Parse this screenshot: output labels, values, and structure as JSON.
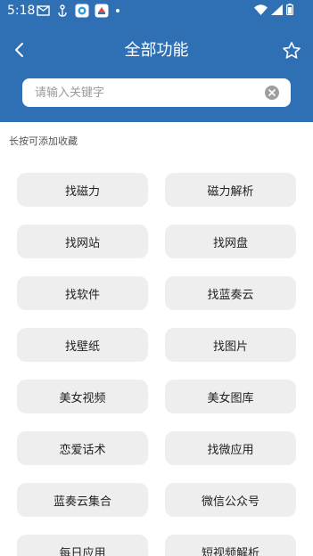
{
  "status_bar": {
    "time": "5:18",
    "icons_left": [
      "mail-icon",
      "anchor-icon",
      "app-icon-a",
      "app-icon-b"
    ],
    "icons_right": [
      "wifi-icon",
      "signal-icon",
      "battery-icon"
    ]
  },
  "header": {
    "title": "全部功能",
    "back_icon": "back-arrow-icon",
    "favorite_icon": "star-icon"
  },
  "search": {
    "placeholder": "请输入关键字",
    "value": ""
  },
  "content": {
    "hint": "长按可添加收藏",
    "functions": [
      {
        "label": "找磁力"
      },
      {
        "label": "磁力解析"
      },
      {
        "label": "找网站"
      },
      {
        "label": "找网盘"
      },
      {
        "label": "找软件"
      },
      {
        "label": "找蓝奏云"
      },
      {
        "label": "找壁纸"
      },
      {
        "label": "找图片"
      },
      {
        "label": "美女视频"
      },
      {
        "label": "美女图库"
      },
      {
        "label": "恋爱话术"
      },
      {
        "label": "找微应用"
      },
      {
        "label": "蓝奏云集合"
      },
      {
        "label": "微信公众号"
      },
      {
        "label": "每日应用"
      },
      {
        "label": "短视频解析"
      }
    ]
  },
  "colors": {
    "header_bg": "#2f6fb4",
    "button_bg": "#eeeeee",
    "content_bg": "#ffffff"
  }
}
